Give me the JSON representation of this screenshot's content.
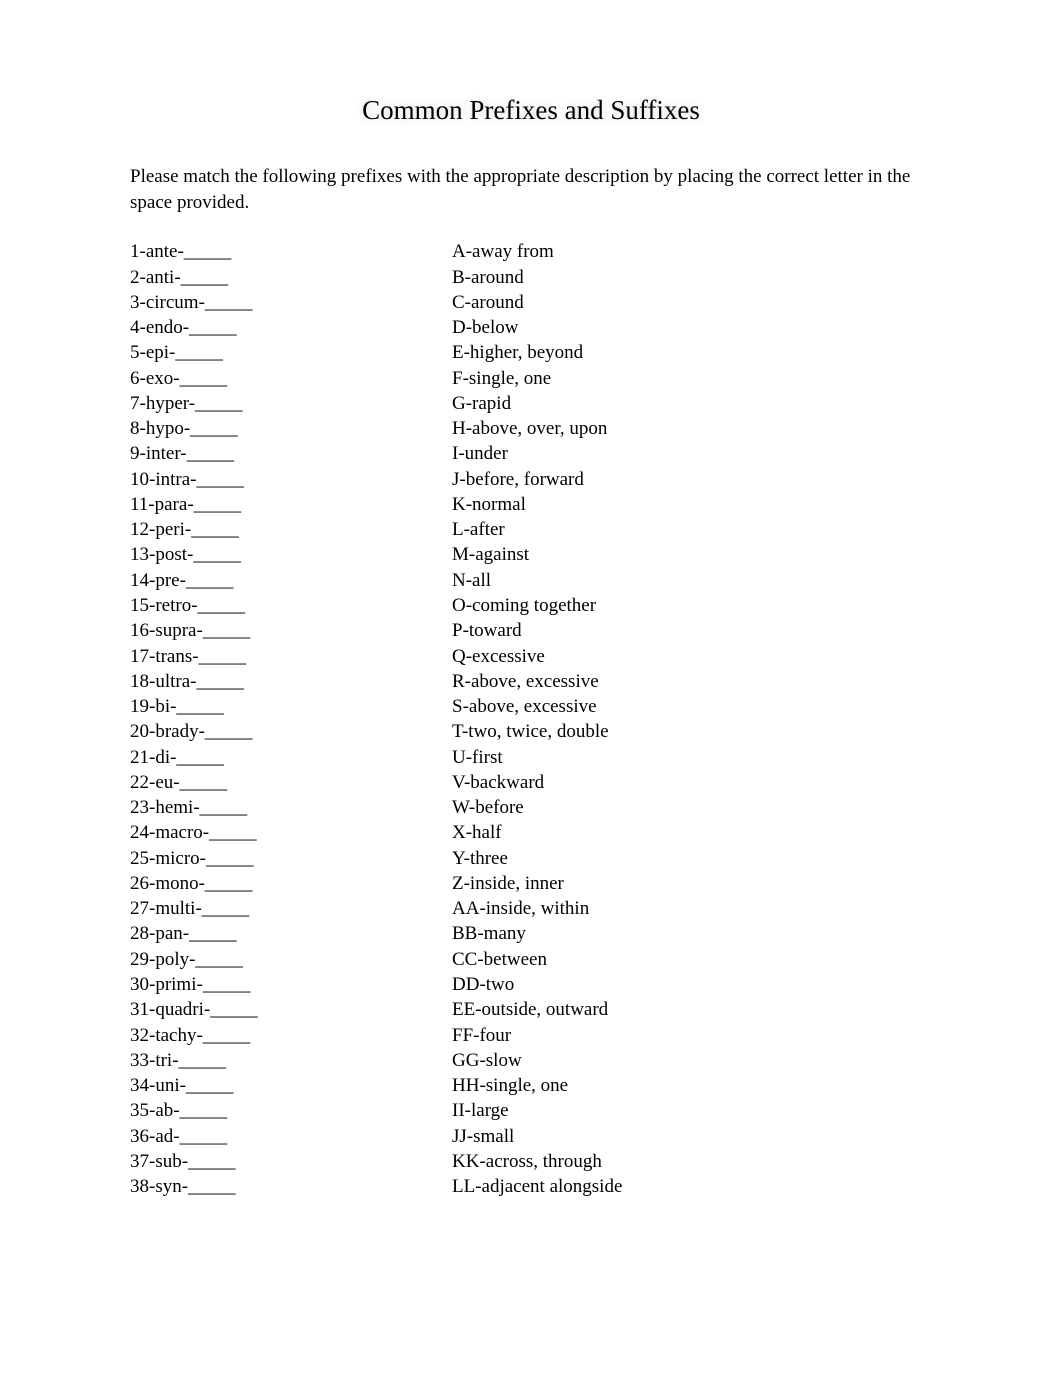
{
  "title": "Common Prefixes and Suffixes",
  "instructions": "Please match the following prefixes with the appropriate description by placing the correct letter in the space provided.",
  "left": [
    "1-ante-_____",
    "2-anti-_____",
    "3-circum-_____",
    "4-endo-_____",
    "5-epi-_____",
    "6-exo-_____",
    "7-hyper-_____",
    "8-hypo-_____",
    "9-inter-_____",
    "10-intra-_____",
    "11-para-_____",
    "12-peri-_____",
    "13-post-_____",
    "14-pre-_____",
    "15-retro-_____",
    "16-supra-_____",
    "17-trans-_____",
    "18-ultra-_____",
    "19-bi-_____",
    "20-brady-_____",
    "21-di-_____",
    "22-eu-_____",
    "23-hemi-_____",
    "24-macro-_____",
    "25-micro-_____",
    "26-mono-_____",
    "27-multi-_____",
    "28-pan-_____",
    "29-poly-_____",
    "30-primi-_____",
    "31-quadri-_____",
    "32-tachy-_____",
    "33-tri-_____",
    "34-uni-_____",
    "35-ab-_____",
    "36-ad-_____",
    "37-sub-_____",
    "38-syn-_____"
  ],
  "right": [
    "A-away from",
    "B-around",
    "C-around",
    "D-below",
    "E-higher, beyond",
    "F-single, one",
    "G-rapid",
    "H-above, over, upon",
    "I-under",
    "J-before, forward",
    "K-normal",
    "L-after",
    "M-against",
    "N-all",
    "O-coming together",
    "P-toward",
    "Q-excessive",
    "R-above, excessive",
    "S-above, excessive",
    "T-two, twice, double",
    "U-first",
    "V-backward",
    "W-before",
    "X-half",
    "Y-three",
    "Z-inside, inner",
    "AA-inside, within",
    "BB-many",
    "CC-between",
    "DD-two",
    "EE-outside, outward",
    "FF-four",
    "GG-slow",
    "HH-single, one",
    "II-large",
    "JJ-small",
    "KK-across, through",
    "LL-adjacent alongside"
  ]
}
